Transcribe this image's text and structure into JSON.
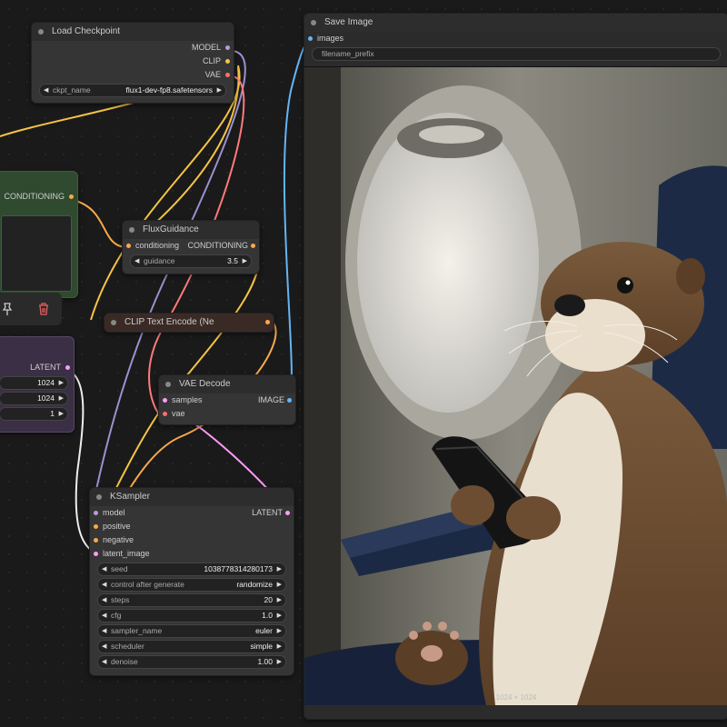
{
  "colors": {
    "model": "#b39ddb",
    "clip": "#f6c445",
    "vae": "#ff6e6e",
    "conditioning": "#f9a94b",
    "latent": "#ff9cf9",
    "image": "#64b5f6",
    "node_bg": "#353535",
    "canvas_bg": "#1a1a1a"
  },
  "load_checkpoint": {
    "title": "Load Checkpoint",
    "outputs": [
      "MODEL",
      "CLIP",
      "VAE"
    ],
    "ckpt_label": "ckpt_name",
    "ckpt_value": "flux1-dev-fp8.safetensors"
  },
  "conditioning_node": {
    "output": "CONDITIONING"
  },
  "flux_guidance": {
    "title": "FluxGuidance",
    "input": "conditioning",
    "output": "CONDITIONING",
    "guidance_label": "guidance",
    "guidance_value": "3.5"
  },
  "clip_text_encode": {
    "title": "CLIP Text Encode (Ne"
  },
  "latent_node": {
    "output": "LATENT",
    "width": "1024",
    "height": "1024",
    "batch": "1"
  },
  "vae_decode": {
    "title": "VAE Decode",
    "inputs": [
      "samples",
      "vae"
    ],
    "output": "IMAGE"
  },
  "ksampler": {
    "title": "KSampler",
    "inputs": [
      "model",
      "positive",
      "negative",
      "latent_image"
    ],
    "output": "LATENT",
    "widgets": [
      {
        "label": "seed",
        "value": "1038778314280173"
      },
      {
        "label": "control after generate",
        "value": "randomize"
      },
      {
        "label": "steps",
        "value": "20"
      },
      {
        "label": "cfg",
        "value": "1.0"
      },
      {
        "label": "sampler_name",
        "value": "euler"
      },
      {
        "label": "scheduler",
        "value": "simple"
      },
      {
        "label": "denoise",
        "value": "1.00"
      }
    ]
  },
  "save_image": {
    "title": "Save Image",
    "input": "images",
    "filename_label": "filename_prefix",
    "image_size": "1024 × 1024"
  },
  "icons": [
    "pin-icon",
    "trash-icon",
    "node-collapse-dot-icon",
    "arrow-left-icon",
    "arrow-right-icon"
  ]
}
